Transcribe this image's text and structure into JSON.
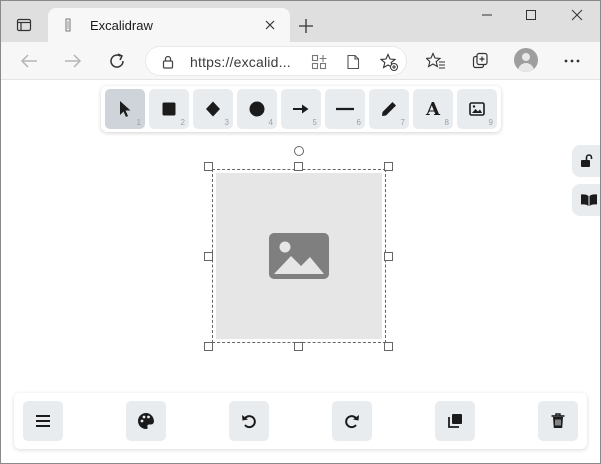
{
  "browser": {
    "tab_title": "Excalidraw",
    "url": "https://excalid..."
  },
  "toolbar": {
    "tools": [
      {
        "name": "selection",
        "key": "1",
        "active": true
      },
      {
        "name": "rectangle",
        "key": "2"
      },
      {
        "name": "diamond",
        "key": "3"
      },
      {
        "name": "ellipse",
        "key": "4"
      },
      {
        "name": "arrow",
        "key": "5"
      },
      {
        "name": "line",
        "key": "6"
      },
      {
        "name": "draw",
        "key": "7"
      },
      {
        "name": "text",
        "key": "8"
      },
      {
        "name": "image",
        "key": "9"
      }
    ]
  },
  "icons": {
    "text_glyph": "A"
  },
  "bottom_bar": {
    "buttons": [
      "menu",
      "style-palette",
      "undo",
      "redo",
      "duplicate",
      "delete"
    ]
  },
  "colors": {
    "tool_bg": "#e9ecef",
    "tool_active_bg": "#ced4da",
    "image_placeholder": "#e6e6e6",
    "image_icon": "#7f7f7f",
    "selection": "#666666"
  }
}
